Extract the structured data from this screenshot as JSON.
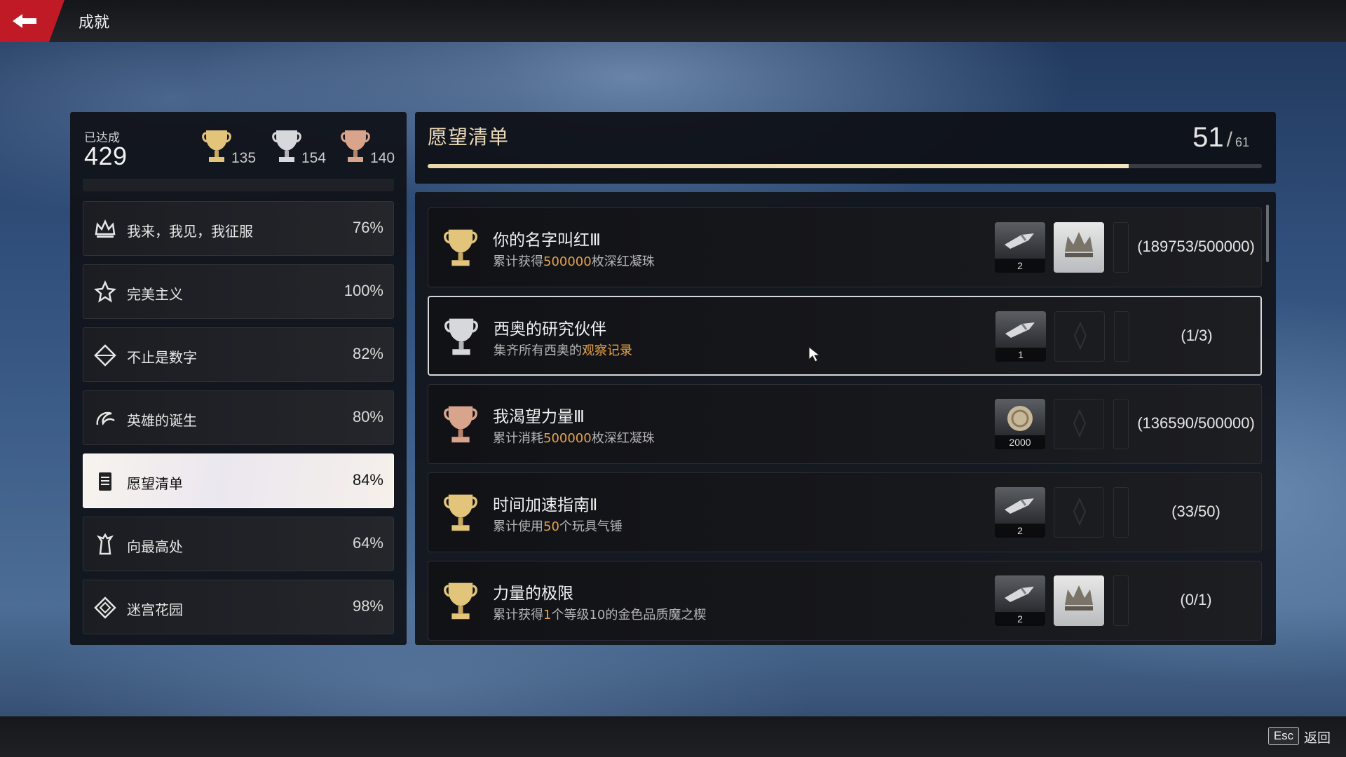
{
  "header": {
    "title": "成就"
  },
  "footer": {
    "esc_key": "Esc",
    "esc_label": "返回"
  },
  "summary": {
    "achieved_label": "已达成",
    "achieved_count": "429",
    "gold": "135",
    "silver": "154",
    "bronze": "140"
  },
  "categories": [
    {
      "name": "我来，我见，我征服",
      "pct": "76%",
      "icon": "crown-icon"
    },
    {
      "name": "完美主义",
      "pct": "100%",
      "icon": "emblem-icon"
    },
    {
      "name": "不止是数字",
      "pct": "82%",
      "icon": "diamond-icon"
    },
    {
      "name": "英雄的诞生",
      "pct": "80%",
      "icon": "swirl-icon"
    },
    {
      "name": "愿望清单",
      "pct": "84%",
      "icon": "scroll-icon"
    },
    {
      "name": "向最高处",
      "pct": "64%",
      "icon": "tower-icon"
    },
    {
      "name": "迷宫花园",
      "pct": "98%",
      "icon": "maze-icon"
    }
  ],
  "list_header": {
    "title": "愿望清单",
    "done": "51",
    "sep": "/",
    "total": "61",
    "progress": 0.84
  },
  "achievements": [
    {
      "tier": "gold",
      "title": "你的名字叫红Ⅲ",
      "desc_pre": "累计获得",
      "desc_hl": "500000",
      "desc_post": "枚深红凝珠",
      "reward1_qty": "2",
      "progress": "(189753/500000)"
    },
    {
      "tier": "silver",
      "title": "西奥的研究伙伴",
      "desc_pre": "集齐所有西奥的",
      "desc_hl": "观察记录",
      "desc_post": "",
      "reward1_qty": "1",
      "progress": "(1/3)"
    },
    {
      "tier": "bronze",
      "title": "我渴望力量Ⅲ",
      "desc_pre": "累计消耗",
      "desc_hl": "500000",
      "desc_post": "枚深红凝珠",
      "reward1_qty": "2000",
      "progress": "(136590/500000)"
    },
    {
      "tier": "gold",
      "title": "时间加速指南Ⅱ",
      "desc_pre": "累计使用",
      "desc_hl": "50",
      "desc_post": "个玩具气锤",
      "reward1_qty": "2",
      "progress": "(33/50)"
    },
    {
      "tier": "gold",
      "title": "力量的极限",
      "desc_pre": "累计获得",
      "desc_hl": "1",
      "desc_post": "个等级10的金色品质魔之楔",
      "reward1_qty": "2",
      "progress": "(0/1)"
    }
  ],
  "colors": {
    "accent_red": "#c01a26",
    "highlight": "#e8a34a",
    "gold": "#e2c47a",
    "silver": "#d6d8dc",
    "bronze": "#d9a48c"
  }
}
